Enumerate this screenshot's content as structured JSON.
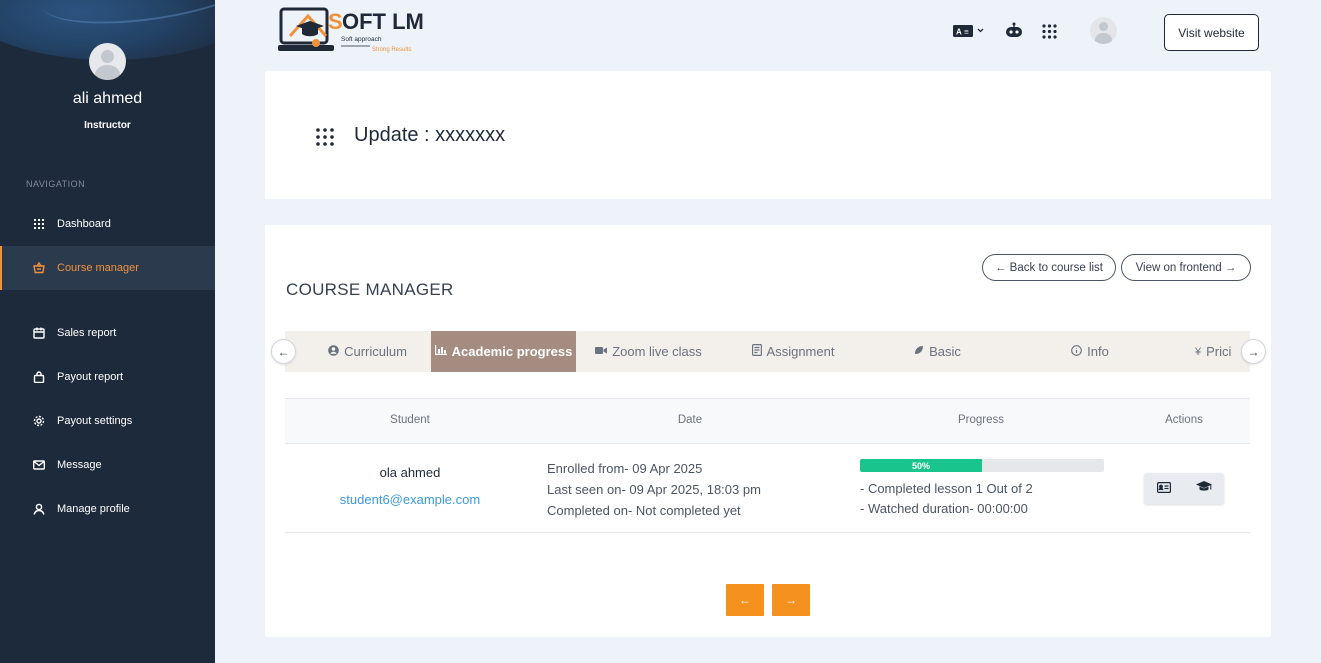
{
  "user": {
    "name": "ali ahmed",
    "role": "Instructor"
  },
  "navigation": {
    "title": "NAVIGATION",
    "items": [
      {
        "label": "Dashboard",
        "icon": "grid-icon"
      },
      {
        "label": "Course manager",
        "icon": "basket-icon",
        "active": true
      },
      {
        "label": "Sales report",
        "icon": "calendar-icon"
      },
      {
        "label": "Payout report",
        "icon": "bag-icon"
      },
      {
        "label": "Payout settings",
        "icon": "gear-icon"
      },
      {
        "label": "Message",
        "icon": "mail-icon"
      },
      {
        "label": "Manage profile",
        "icon": "user-icon"
      }
    ]
  },
  "header": {
    "logo_text": "SOFT LMS",
    "logo_tagline_1": "Soft approach",
    "logo_tagline_2": "Strong Results",
    "visit_label": "Visit website"
  },
  "page": {
    "title": "Update : xxxxxxx"
  },
  "course_manager": {
    "title": "COURSE MANAGER",
    "back_label": "← Back to course list",
    "frontend_label": "View on frontend →",
    "tabs": [
      {
        "label": "Curriculum",
        "icon": "user-circle-icon"
      },
      {
        "label": "Academic progress",
        "icon": "bar-chart-icon",
        "active": true
      },
      {
        "label": "Zoom live class",
        "icon": "video-icon"
      },
      {
        "label": "Assignment",
        "icon": "document-icon"
      },
      {
        "label": "Basic",
        "icon": "leaf-icon"
      },
      {
        "label": "Info",
        "icon": "info-icon"
      },
      {
        "label": "Prici",
        "icon": "yen-icon"
      }
    ],
    "table": {
      "headers": {
        "student": "Student",
        "date": "Date",
        "progress": "Progress",
        "actions": "Actions"
      },
      "rows": [
        {
          "name": "ola ahmed",
          "email": "student6@example.com",
          "enrolled": "Enrolled from- 09 Apr 2025",
          "last_seen": "Last seen on- 09 Apr 2025, 18:03 pm",
          "completed": "Completed on- Not completed yet",
          "progress_percent": 50,
          "progress_label": "50%",
          "lessons": "- Completed lesson 1 Out of 2",
          "watched": "- Watched duration- 00:00:00"
        }
      ]
    },
    "pager": {
      "prev": "←",
      "next": "→"
    }
  },
  "colors": {
    "accent": "#f5921f",
    "active_nav": "#f0923c",
    "active_tab": "#a48c80",
    "progress": "#19c58d",
    "sidebar": "#1d2a3c",
    "email_link": "#3b9ad9"
  }
}
